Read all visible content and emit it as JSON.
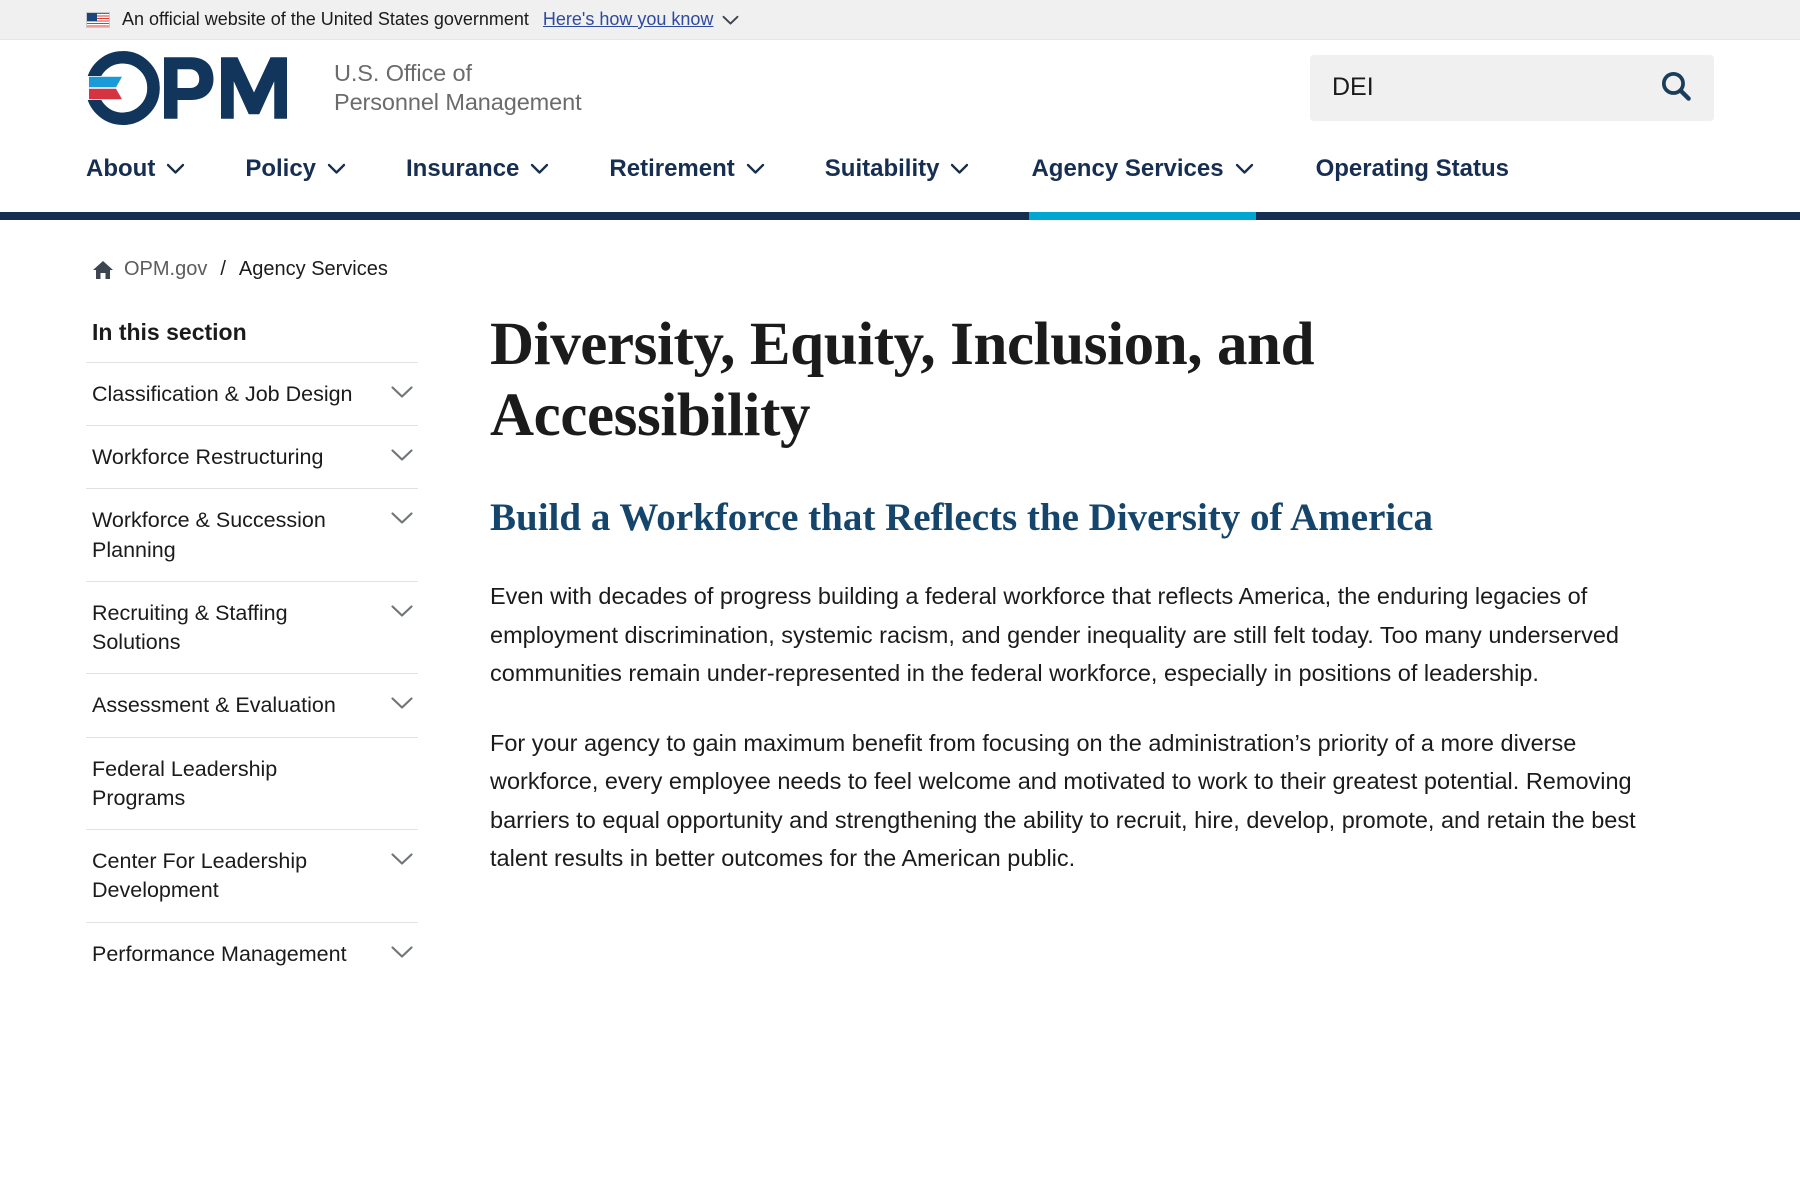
{
  "gov_banner": {
    "flag_icon": "us-flag-icon",
    "text": "An official website of the United States government",
    "link_label": "Here's how you know",
    "chevron_icon": "chevron-down-icon"
  },
  "header": {
    "logo_mark": "opm-logo-icon",
    "logo_line1": "U.S. Office of",
    "logo_line2": "Personnel Management",
    "search": {
      "value": "DEI",
      "placeholder": "Search",
      "icon": "search-icon"
    }
  },
  "nav": {
    "items": [
      {
        "label": "About",
        "has_dropdown": true,
        "active": false
      },
      {
        "label": "Policy",
        "has_dropdown": true,
        "active": false
      },
      {
        "label": "Insurance",
        "has_dropdown": true,
        "active": false
      },
      {
        "label": "Retirement",
        "has_dropdown": true,
        "active": false
      },
      {
        "label": "Suitability",
        "has_dropdown": true,
        "active": false
      },
      {
        "label": "Agency Services",
        "has_dropdown": true,
        "active": true
      },
      {
        "label": "Operating Status",
        "has_dropdown": false,
        "active": false
      }
    ],
    "active_underline_color": "#00a6d2",
    "bar_color": "#162e51"
  },
  "breadcrumb": {
    "home_icon": "home-icon",
    "home_label": "OPM.gov",
    "separator": "/",
    "current": "Agency Services"
  },
  "sidebar": {
    "title": "In this section",
    "items": [
      {
        "label": "Classification & Job Design",
        "has_chevron": true
      },
      {
        "label": "Workforce Restructuring",
        "has_chevron": true
      },
      {
        "label": "Workforce & Succession Planning",
        "has_chevron": true
      },
      {
        "label": "Recruiting & Staffing Solutions",
        "has_chevron": true
      },
      {
        "label": "Assessment & Evaluation",
        "has_chevron": true
      },
      {
        "label": "Federal Leadership Programs",
        "has_chevron": false
      },
      {
        "label": "Center For Leadership Development",
        "has_chevron": true
      },
      {
        "label": "Performance Management",
        "has_chevron": true
      }
    ]
  },
  "main": {
    "page_title": "Diversity, Equity, Inclusion, and Accessibility",
    "section_title": "Build a Workforce that Reflects the Diversity of America",
    "paragraph_1": "Even with decades of progress building a federal workforce that reflects America, the enduring legacies of employment discrimination, systemic racism, and gender inequality are still felt today. Too many underserved communities remain under-represented in the federal workforce, especially in positions of leadership.",
    "paragraph_2": "For your agency to gain maximum benefit from focusing on the administration’s priority of a more diverse workforce, every employee needs to feel welcome and motivated to work to their greatest potential. Removing barriers to equal opportunity and strengthening the ability to recruit, hire, develop, promote, and retain the best talent results in better outcomes for the American public."
  },
  "colors": {
    "navy": "#162e51",
    "heading_blue": "#16456b",
    "accent_cyan": "#00a6d2",
    "banner_bg": "#f0f0f0",
    "link_blue": "#2e4a9e",
    "logo_red": "#d5333f",
    "logo_blue": "#1a9ad6"
  }
}
